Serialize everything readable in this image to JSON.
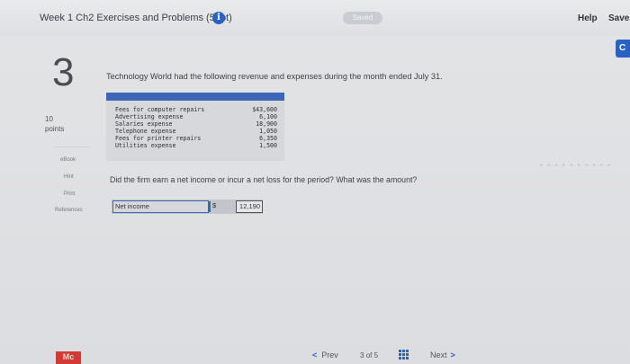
{
  "header": {
    "assignment_title": "Week 1 Ch2 Exercises and Problems (50pt)",
    "info_icon": "info-icon",
    "saved_label": "Saved",
    "help_label": "Help",
    "save_exit_label": "Save",
    "corner_button_label": "C"
  },
  "question": {
    "number": "3",
    "points_value": "10",
    "points_label": "points",
    "text": "Technology World had the following revenue and expenses during the month ended July 31.",
    "table": [
      {
        "label": "Fees for computer repairs",
        "amount": "$43,600"
      },
      {
        "label": "Advertising expense",
        "amount": "6,100"
      },
      {
        "label": "Salaries expense",
        "amount": "18,900"
      },
      {
        "label": "Telephone expense",
        "amount": "1,050"
      },
      {
        "label": "Fees for printer repairs",
        "amount": "6,350"
      },
      {
        "label": "Utilities expense",
        "amount": "1,500"
      }
    ],
    "prompt": "Did the firm earn a net income or incur a net loss for the period? What was the amount?",
    "answer": {
      "label": "Net income",
      "currency": "$",
      "value": "12,190"
    }
  },
  "sidebar": {
    "links": [
      "eBook",
      "Hint",
      "Print",
      "References"
    ]
  },
  "footer": {
    "logo_text": "Mc",
    "prev_label": "Prev",
    "page_current": "3",
    "page_of": "of",
    "page_total": "5",
    "next_label": "Next"
  },
  "colors": {
    "accent": "#2a62c4",
    "table_header": "#3d66b7",
    "logo": "#d23a36"
  }
}
